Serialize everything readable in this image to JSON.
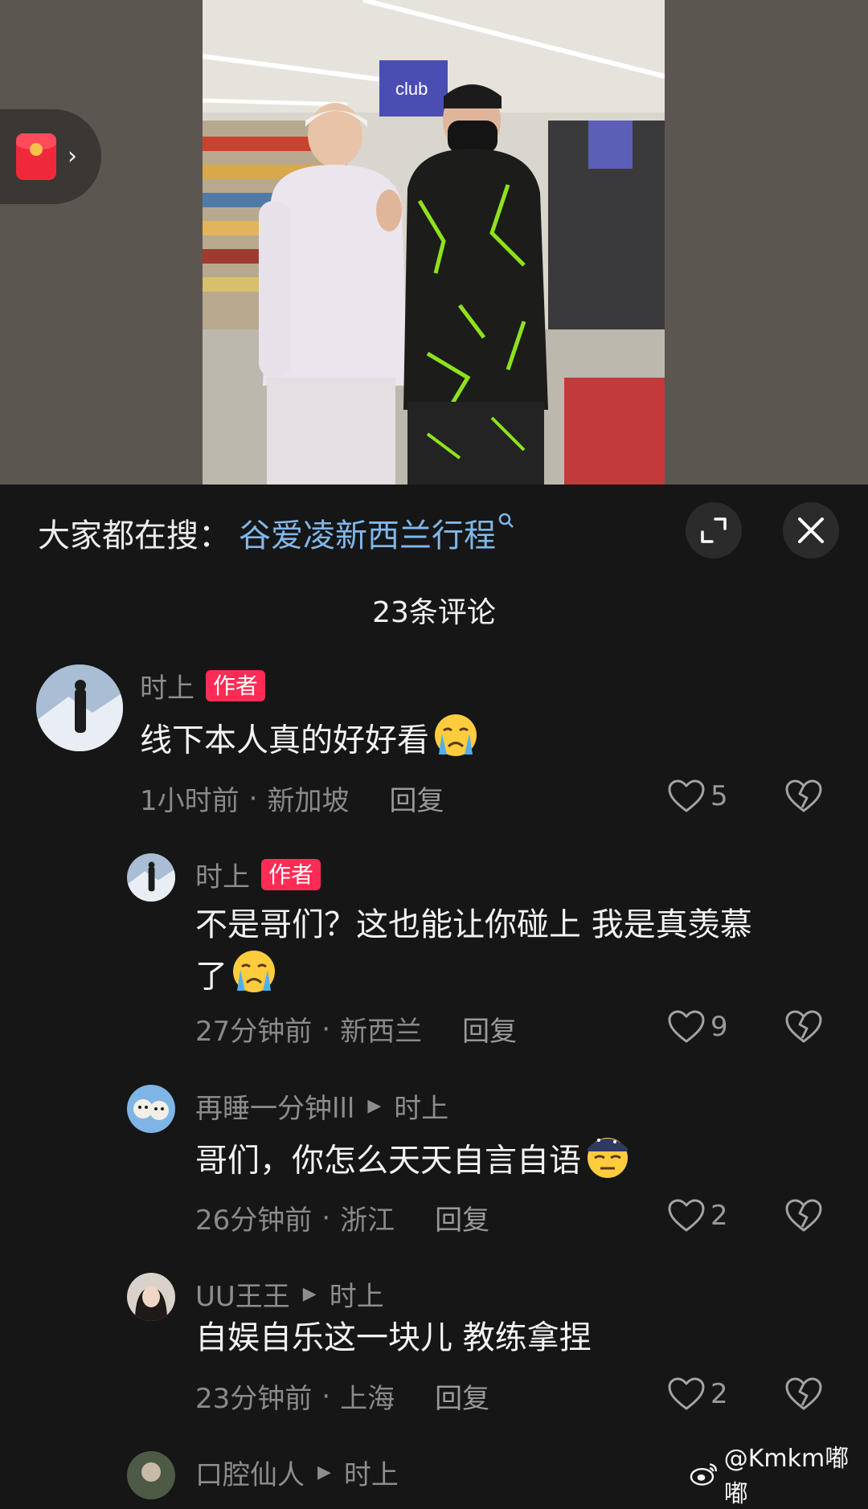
{
  "search": {
    "prefix": "大家都在搜：",
    "term": "谷爱凌新西兰行程"
  },
  "comments_header": {
    "count_label": "23条评论"
  },
  "comments": [
    {
      "user": "时上",
      "tag": "作者",
      "text_lines": [
        "线下本人真的好好看"
      ],
      "time": "1小时前",
      "location": "新加坡",
      "reply_label": "回复",
      "likes": "5"
    },
    {
      "user": "时上",
      "tag": "作者",
      "text_lines": [
        "不是哥们？这也能让你碰上 我是真羡慕",
        "了"
      ],
      "time": "27分钟前",
      "location": "新西兰",
      "reply_label": "回复",
      "likes": "9"
    },
    {
      "user": "再睡一分钟lll",
      "reply_to": "时上",
      "text_lines": [
        "哥们，你怎么天天自言自语"
      ],
      "time": "26分钟前",
      "location": "浙江",
      "reply_label": "回复",
      "likes": "2"
    },
    {
      "user": "UU王王",
      "reply_to": "时上",
      "text_lines": [
        "自娱自乐这一块儿 教练拿捏"
      ],
      "time": "23分钟前",
      "location": "上海",
      "reply_label": "回复",
      "likes": "2"
    },
    {
      "user": "口腔仙人",
      "reply_to": "时上"
    }
  ],
  "meta_separator": "·",
  "watermark": "@Kmkm嘟嘟",
  "colors": {
    "author_tag": "#fe2c55",
    "search_term": "#7fb7ea",
    "sheet_background": "#161616"
  },
  "icons": [
    "red-packet-icon",
    "expand-icon",
    "close-icon",
    "heart-icon",
    "broken-heart-icon",
    "crying-emoji",
    "rolling-eyes-emoji",
    "weibo-icon"
  ]
}
